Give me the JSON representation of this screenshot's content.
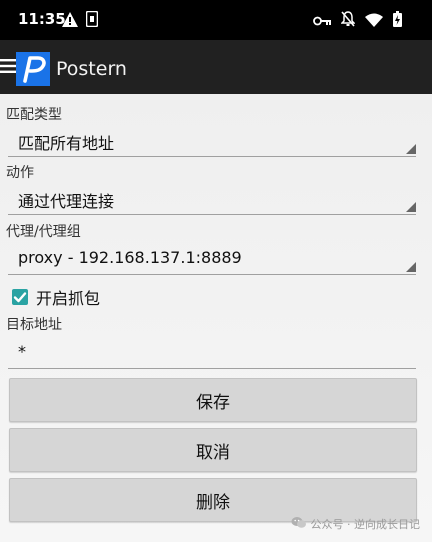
{
  "status_bar": {
    "time": "11:35",
    "left_icons": [
      "warning-icon",
      "sim-icon"
    ],
    "right_icons": [
      "vpn-key-icon",
      "notifications-off-icon",
      "wifi-icon",
      "battery-icon"
    ]
  },
  "app_bar": {
    "title": "Postern",
    "logo_letter": "P",
    "colors": {
      "background": "#212121",
      "logo": "#1a73e8"
    }
  },
  "form": {
    "match_type": {
      "label": "匹配类型",
      "value": "匹配所有地址"
    },
    "action": {
      "label": "动作",
      "value": "通过代理连接"
    },
    "proxy": {
      "label": "代理/代理组",
      "value": "proxy - 192.168.137.1:8889"
    },
    "capture": {
      "label": "开启抓包",
      "checked": true,
      "color": "#2aa3a3"
    },
    "target": {
      "label": "目标地址",
      "value": "*"
    }
  },
  "buttons": {
    "save": "保存",
    "cancel": "取消",
    "delete": "删除"
  },
  "watermark": {
    "text": "公众号 · 逆向成长日记",
    "icon": "wechat-icon"
  }
}
